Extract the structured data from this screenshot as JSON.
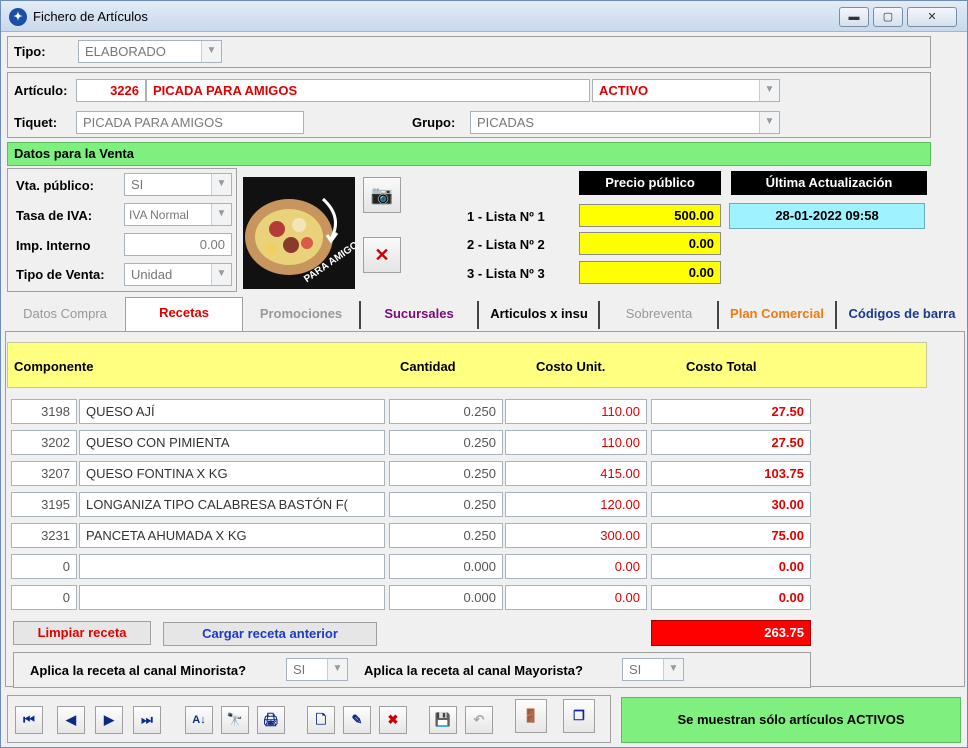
{
  "window": {
    "title": "Fichero de Artículos"
  },
  "tipo": {
    "label": "Tipo:",
    "value": "ELABORADO"
  },
  "articulo": {
    "label": "Artículo:",
    "code": "3226",
    "name": "PICADA PARA AMIGOS",
    "status": "ACTIVO"
  },
  "tiquet": {
    "label": "Tiquet:",
    "value": "PICADA PARA AMIGOS"
  },
  "grupo": {
    "label": "Grupo:",
    "value": "PICADAS"
  },
  "venta": {
    "header": "Datos para la Venta",
    "vta_publico_label": "Vta. público:",
    "vta_publico": "SI",
    "tasa_iva_label": "Tasa de IVA:",
    "tasa_iva": "IVA Normal",
    "imp_interno_label": "Imp. Interno",
    "imp_interno": "0.00",
    "tipo_venta_label": "Tipo de Venta:",
    "tipo_venta": "Unidad",
    "image_caption": "PARA AMIGOS"
  },
  "precios": {
    "header": "Precio público",
    "lists": [
      {
        "label": "1 - Lista Nº 1",
        "value": "500.00"
      },
      {
        "label": "2 - Lista Nº 2",
        "value": "0.00"
      },
      {
        "label": "3 - Lista Nº 3",
        "value": "0.00"
      }
    ]
  },
  "actualizacion": {
    "header": "Última Actualización",
    "value": "28-01-2022 09:58"
  },
  "tabs": [
    "Datos Compra",
    "Recetas",
    "Promociones",
    "Sucursales",
    "Articulos x insu",
    "Sobreventa",
    "Plan Comercial",
    "Códigos de barra"
  ],
  "receta": {
    "headers": [
      "Componente",
      "Cantidad",
      "Costo Unit.",
      "Costo Total"
    ],
    "rows": [
      {
        "code": "3198",
        "name": "QUESO AJÍ",
        "qty": "0.250",
        "unit": "110.00",
        "total": "27.50"
      },
      {
        "code": "3202",
        "name": "QUESO CON PIMIENTA",
        "qty": "0.250",
        "unit": "110.00",
        "total": "27.50"
      },
      {
        "code": "3207",
        "name": "QUESO FONTINA X KG",
        "qty": "0.250",
        "unit": "415.00",
        "total": "103.75"
      },
      {
        "code": "3195",
        "name": "LONGANIZA TIPO CALABRESA BASTÓN  F(",
        "qty": "0.250",
        "unit": "120.00",
        "total": "30.00"
      },
      {
        "code": "3231",
        "name": "PANCETA AHUMADA X KG",
        "qty": "0.250",
        "unit": "300.00",
        "total": "75.00"
      },
      {
        "code": "0",
        "name": "",
        "qty": "0.000",
        "unit": "0.00",
        "total": "0.00"
      },
      {
        "code": "0",
        "name": "",
        "qty": "0.000",
        "unit": "0.00",
        "total": "0.00"
      }
    ],
    "limpiar": "Limpiar receta",
    "cargar": "Cargar receta anterior",
    "total": "263.75",
    "minorista_label": "Aplica la receta al canal Minorista?",
    "minorista": "SI",
    "mayorista_label": "Aplica la receta al canal Mayorista?",
    "mayorista": "SI"
  },
  "footer": {
    "status": "Se muestran sólo artículos ACTIVOS"
  }
}
